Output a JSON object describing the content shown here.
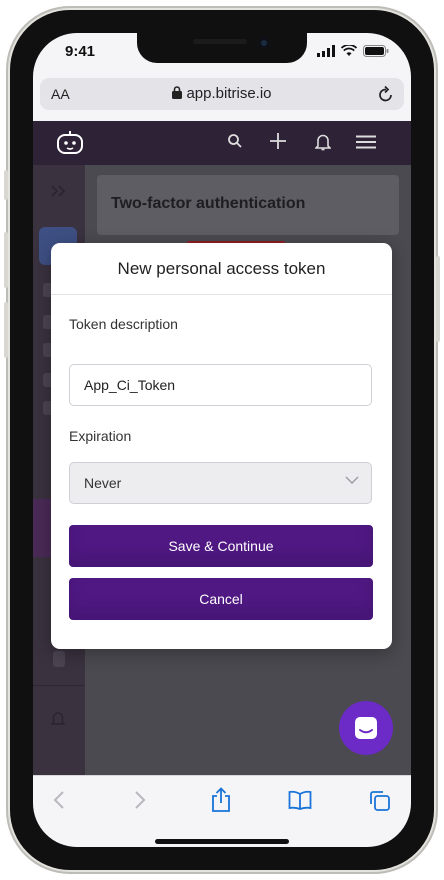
{
  "status_bar": {
    "time": "9:41"
  },
  "browser": {
    "text_size_label": "AA",
    "url": "app.bitrise.io"
  },
  "page": {
    "card_title": "Two-factor authentication"
  },
  "modal": {
    "title": "New personal access token",
    "token_description_label": "Token description",
    "token_description_value": "App_Ci_Token",
    "expiration_label": "Expiration",
    "expiration_value": "Never",
    "primary_button": "Save & Continue",
    "secondary_button": "Cancel"
  },
  "colors": {
    "brand_purple": "#4f1883",
    "appbar": "#2d2236",
    "chat_fab": "#6c2ac6"
  },
  "icons": [
    "bitrise-logo-icon",
    "search-icon",
    "plus-icon",
    "bell-icon",
    "hamburger-menu-icon",
    "lock-icon",
    "reload-icon",
    "back-icon",
    "forward-icon",
    "share-icon",
    "bookmarks-icon",
    "tabs-icon",
    "chat-icon",
    "chevron-down-icon",
    "collapse-sidebar-icon"
  ]
}
